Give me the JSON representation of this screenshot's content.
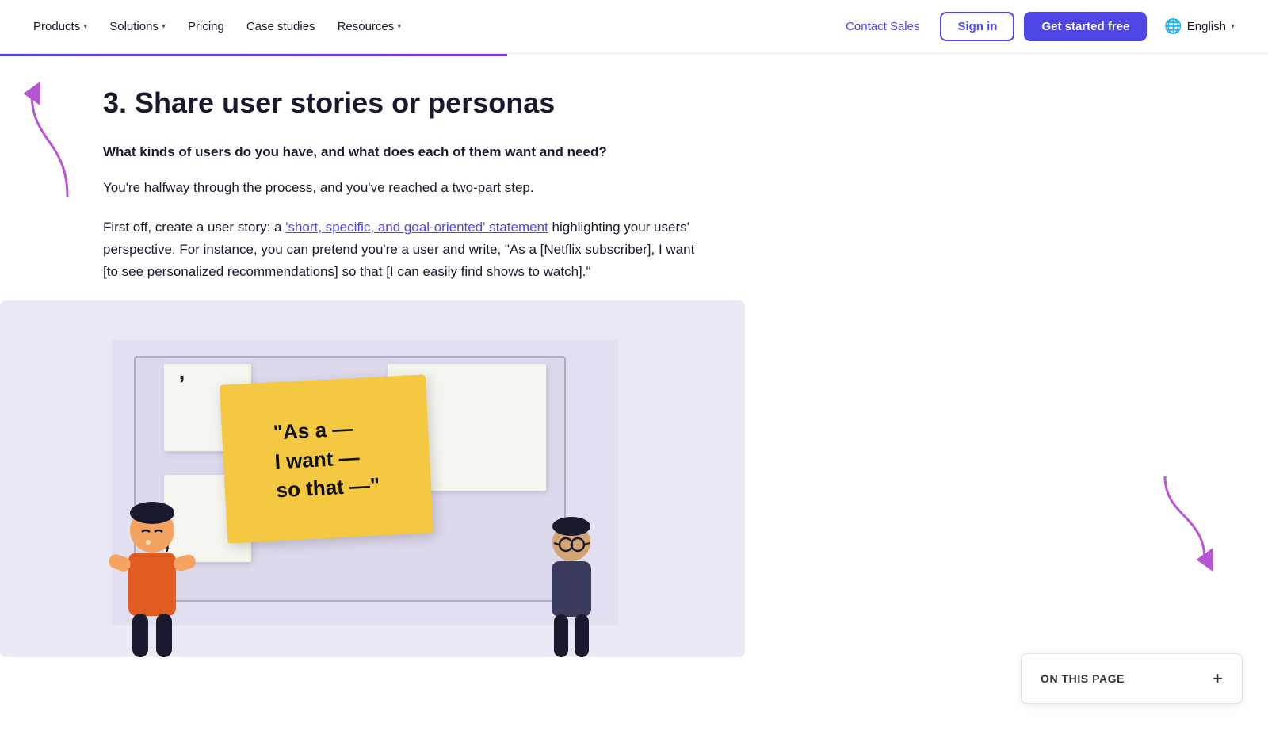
{
  "nav": {
    "products_label": "Products",
    "solutions_label": "Solutions",
    "pricing_label": "Pricing",
    "case_studies_label": "Case studies",
    "resources_label": "Resources",
    "contact_sales_label": "Contact Sales",
    "sign_in_label": "Sign in",
    "get_started_label": "Get started free",
    "language_label": "English"
  },
  "content": {
    "section_heading": "3. Share user stories or personas",
    "subheading": "What kinds of users do you have, and what does each of them want and need?",
    "para1": "You're halfway through the process, and you've reached a two-part step.",
    "para2_prefix": "First off, create a user story: a ",
    "para2_link": "'short, specific, and goal-oriented' statement",
    "para2_suffix": " highlighting your users' perspective. For instance, you can pretend you're a user and write, \"As a [Netflix subscriber], I want [to see personalized recommendations] so that [I can easily find shows to watch].\""
  },
  "sticky": {
    "line1": "\"As a —",
    "line2": "I want —",
    "line3": "so that —\""
  },
  "on_this_page": {
    "label": "ON THIS PAGE",
    "plus_icon": "+"
  }
}
